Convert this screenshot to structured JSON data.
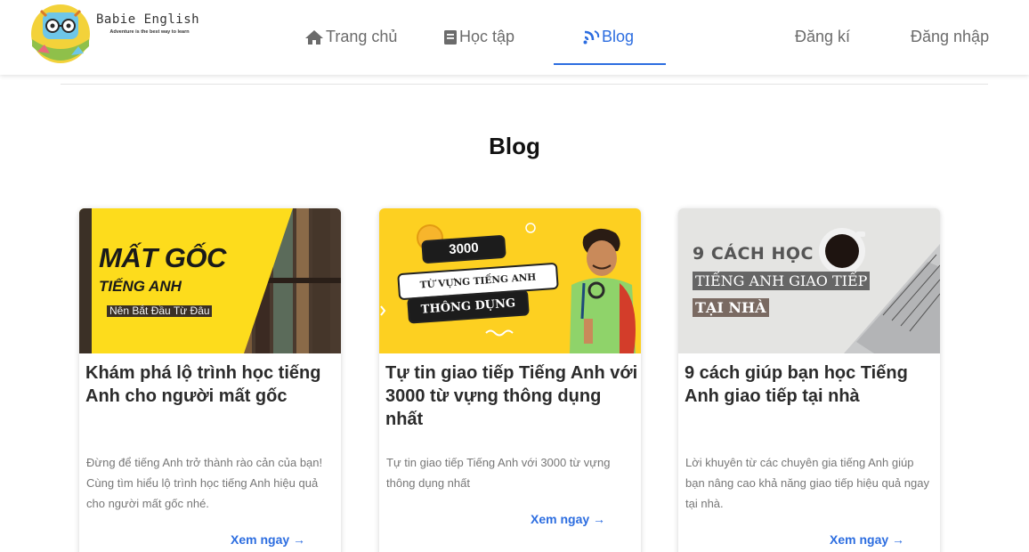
{
  "brand": {
    "name": "Babie English",
    "tagline": "Adventure is the best way to learn"
  },
  "nav": {
    "items": [
      {
        "label": "Trang chủ",
        "icon": "home-icon",
        "active": false
      },
      {
        "label": "Học tập",
        "icon": "book-icon",
        "active": false
      },
      {
        "label": "Blog",
        "icon": "blog-icon",
        "active": true
      }
    ],
    "register": "Đăng kí",
    "login": "Đăng nhập",
    "accent": "#2c6de0"
  },
  "page": {
    "title": "Blog"
  },
  "cards": [
    {
      "title": "Khám phá lộ trình học tiếng Anh cho người mất gốc",
      "description": "Đừng để tiếng Anh trở thành rào cản của bạn! Cùng tìm hiểu lộ trình học tiếng Anh hiệu quả cho người mất gốc nhé.",
      "link": "Xem ngay →",
      "thumbnail": {
        "line1": "MẤT GỐC",
        "line2": "TIẾNG ANH",
        "line3": "Nên Bắt Đầu Từ Đâu"
      }
    },
    {
      "title": "Tự tin giao tiếp Tiếng Anh với 3000 từ vựng thông dụng nhất",
      "description": "Tự tin giao tiếp Tiếng Anh với 3000 từ vựng thông dụng nhất",
      "link": "Xem ngay →",
      "thumbnail": {
        "line1": "3000",
        "line2": "TỪ VỰNG TIẾNG ANH",
        "line3": "THÔNG DỤNG"
      }
    },
    {
      "title": "9 cách giúp bạn học Tiếng Anh giao tiếp tại nhà",
      "description": "Lời khuyên từ các chuyên gia tiếng Anh giúp bạn nâng cao khả năng giao tiếp hiệu quả ngay tại nhà.",
      "link": "Xem ngay →",
      "thumbnail": {
        "line1": "9 CÁCH HỌC",
        "line2": "TIẾNG ANH GIAO TIẾP",
        "line3": "TẠI NHÀ"
      }
    }
  ]
}
